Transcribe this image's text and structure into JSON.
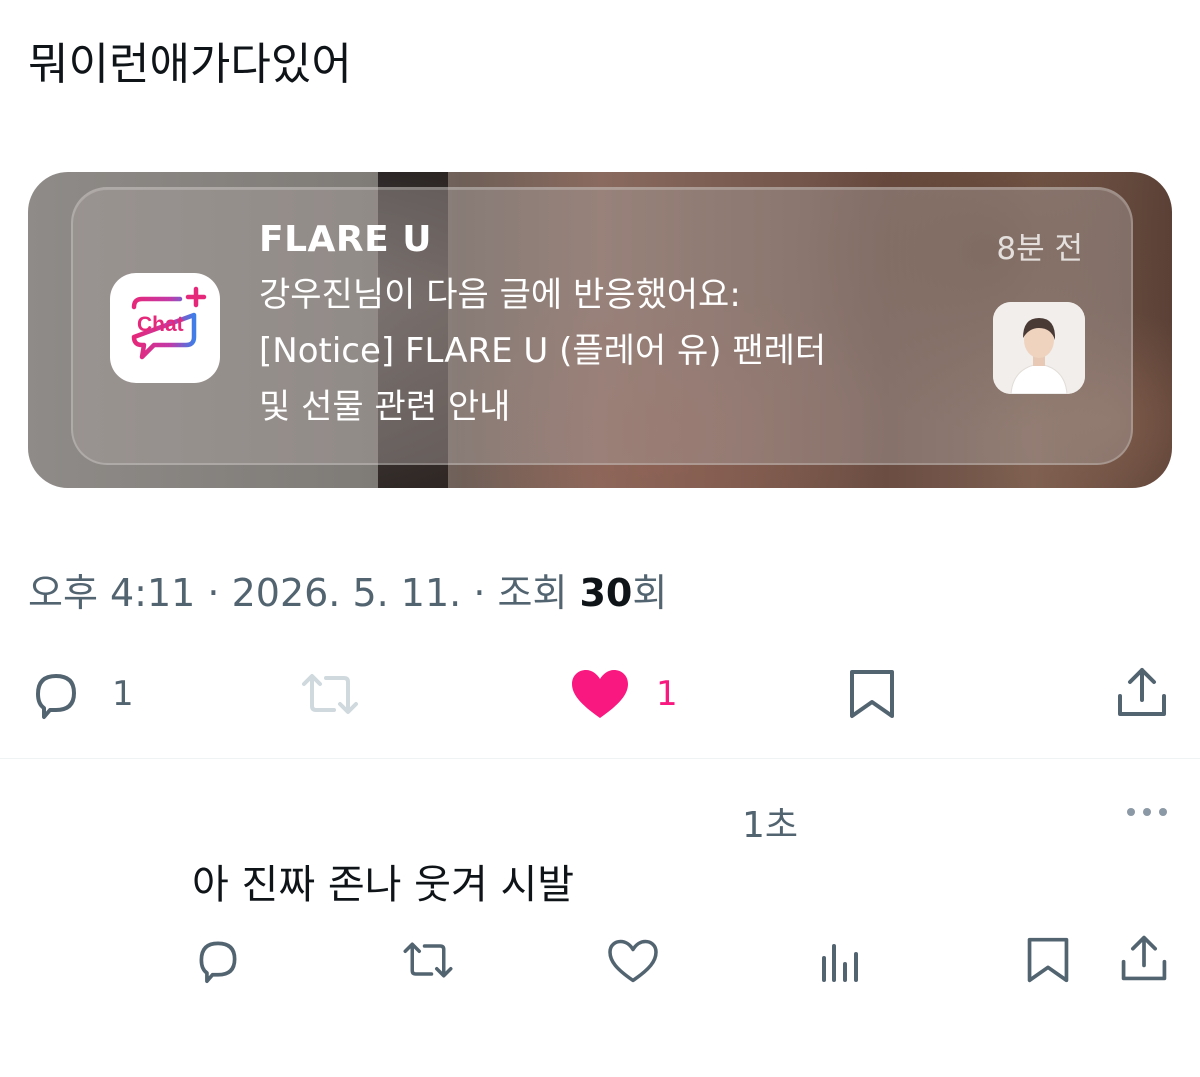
{
  "tweet": {
    "text": "뭐이런애가다있어"
  },
  "notification": {
    "app_name": "FLARE U",
    "time": "8분 전",
    "app_icon_label": "Chat",
    "body_lines": [
      "강우진님이 다음 글에 반응했어요:",
      "[Notice] FLARE U (플레어 유) 팬레터",
      "및 선물 관련 안내"
    ]
  },
  "meta": {
    "time": "오후 4:11",
    "sep": " · ",
    "date": "2026. 5. 11.",
    "views_label": "조회 ",
    "views_count": "30",
    "views_suffix": "회"
  },
  "actions": {
    "reply_count": "1",
    "like_count": "1"
  },
  "reply": {
    "time": "1초",
    "text": "아 진짜 존나 웃겨 시발"
  },
  "colors": {
    "like": "#f91880",
    "text_secondary": "#536471",
    "retweet_disabled": "#cfd9de",
    "chat_pink": "#e6287a",
    "chat_blue": "#3f7de8"
  }
}
